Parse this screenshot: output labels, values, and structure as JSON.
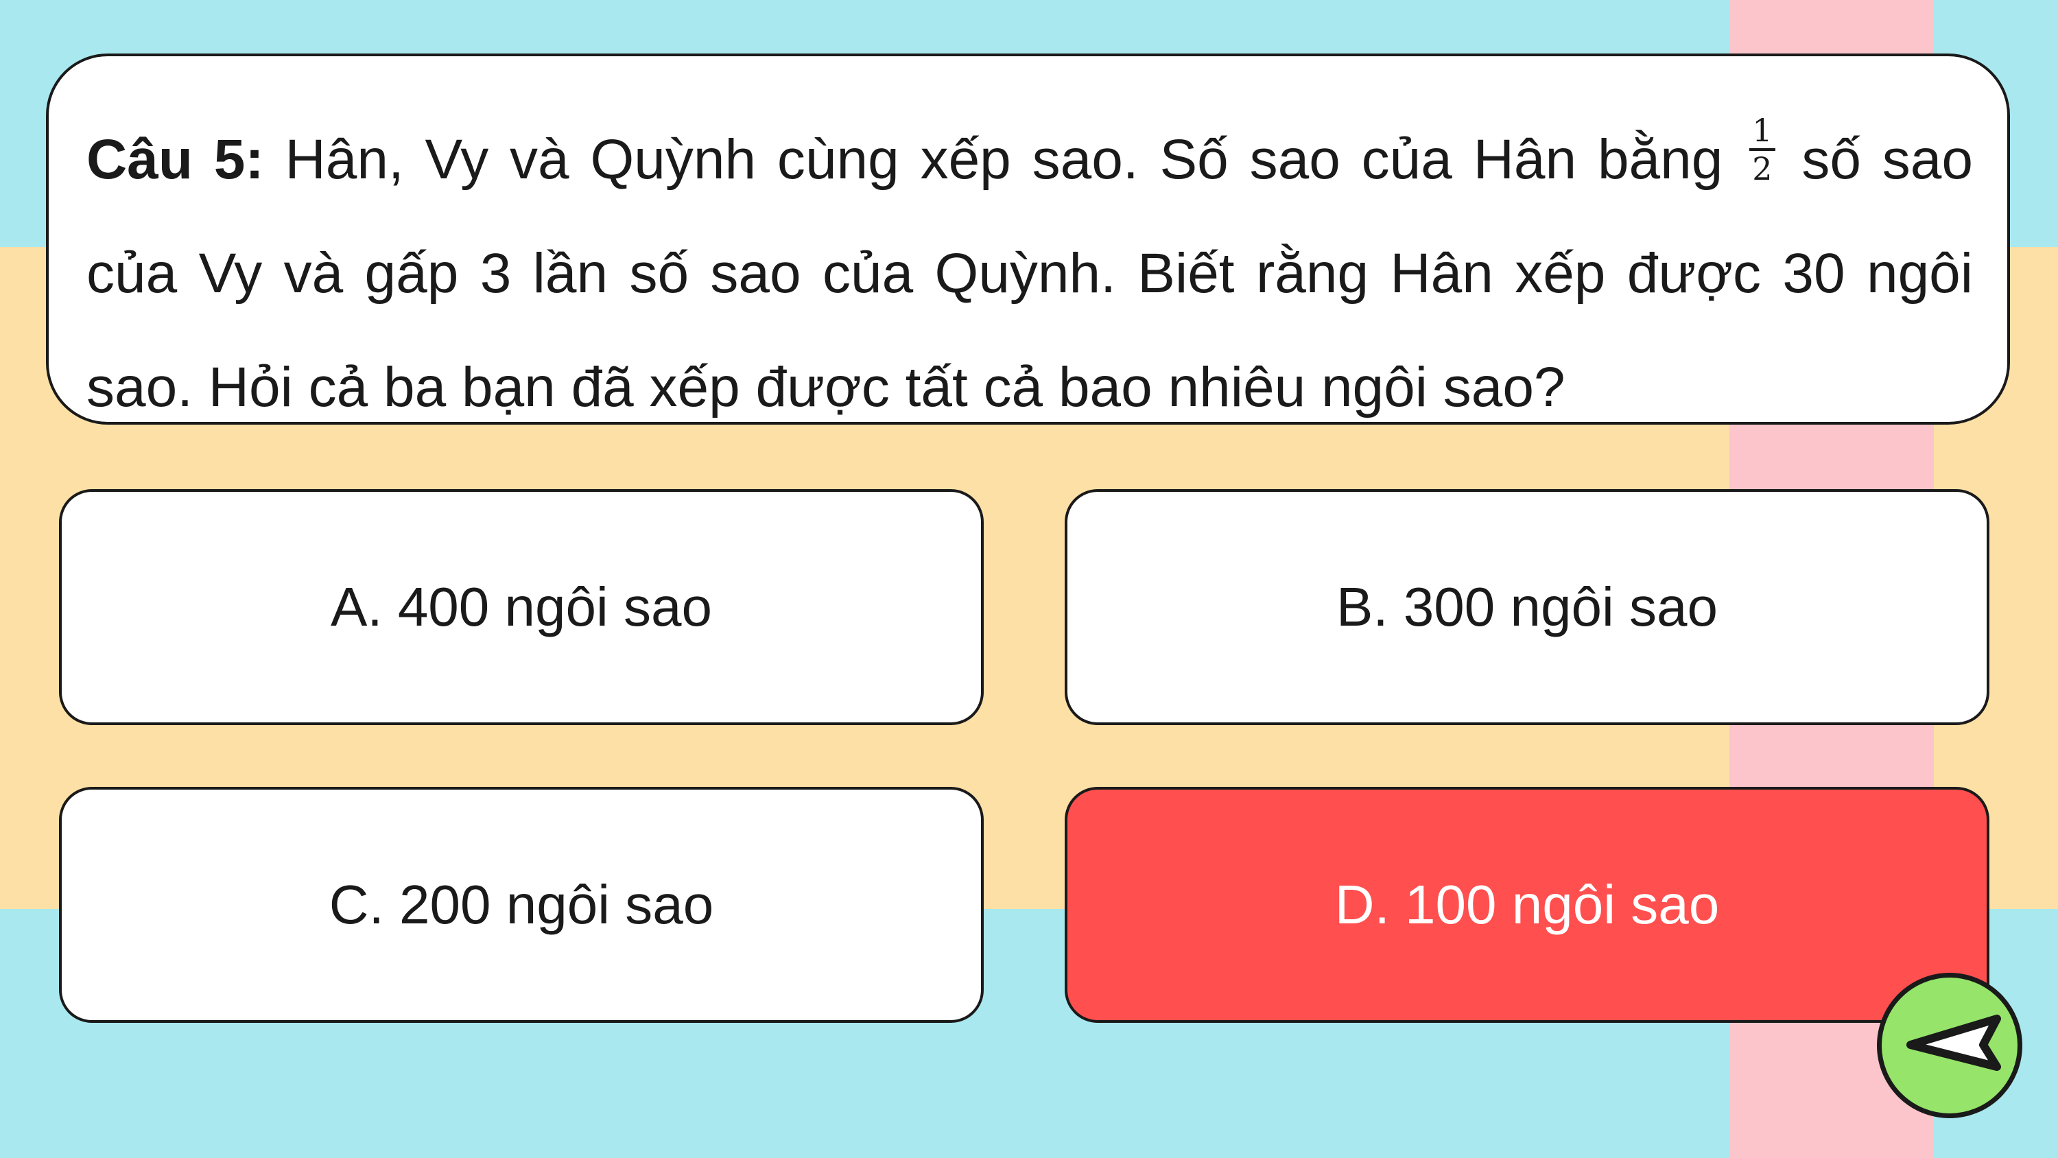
{
  "colors": {
    "background": "#a9e8ef",
    "band": "#fde0a6",
    "stripe": "#fcc5cb",
    "card": "#ffffff",
    "selected_answer": "#ff4f4e",
    "back_button": "#96e46a"
  },
  "question": {
    "label": "Câu 5:",
    "text_before_fraction": " Hân, Vy và Quỳnh cùng xếp sao. Số sao của Hân bằng ",
    "fraction_numerator": "1",
    "fraction_denominator": "2",
    "text_after_fraction": " số sao của Vy và gấp 3 lần số sao của Quỳnh. Biết rằng Hân xếp được 30 ngôi sao. Hỏi cả ba bạn đã xếp được tất cả bao nhiêu ngôi sao?"
  },
  "answers": [
    {
      "label": "A. 400 ngôi sao",
      "selected": false
    },
    {
      "label": "B. 300 ngôi sao",
      "selected": false
    },
    {
      "label": "C. 200 ngôi sao",
      "selected": false
    },
    {
      "label": "D. 100 ngôi sao",
      "selected": true
    }
  ],
  "back_button": {
    "icon": "back-arrow-icon"
  }
}
